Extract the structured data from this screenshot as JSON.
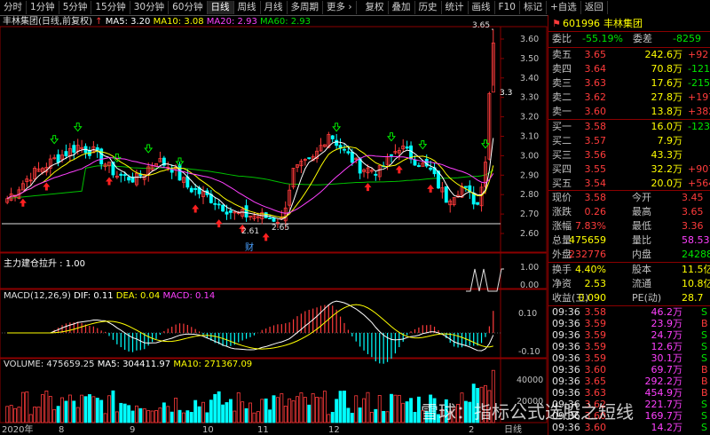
{
  "toolbar": {
    "items": [
      "分时",
      "1分钟",
      "5分钟",
      "15分钟",
      "30分钟",
      "60分钟",
      "日线",
      "周线",
      "月线",
      "多周期",
      "更多 ›"
    ],
    "right_items": [
      "复权",
      "叠加",
      "历史",
      "统计",
      "画线",
      "F10",
      "标记",
      "+自选",
      "返回"
    ]
  },
  "chart_header": {
    "name": "丰林集团(日线,前复权)",
    "ma5": "MA5: 3.20",
    "ma10": "MA10: 3.08",
    "ma20": "MA20: 2.93",
    "ma60": "MA60: 2.93"
  },
  "annotations": {
    "high_label": "3.65",
    "low_label": "2.65",
    "low_label2": "2.61",
    "cai_label": "财",
    "year_label": "2020年",
    "tick_label": "3.3"
  },
  "main_axis": {
    "labels": [
      "3.60",
      "3.50",
      "3.40",
      "3.30",
      "3.20",
      "3.10",
      "3.00",
      "2.90",
      "2.80",
      "2.70",
      "2.60"
    ]
  },
  "indicator1": {
    "label": "主力建仓拉升 : 1.00",
    "axis": [
      "1.00",
      "0.00"
    ]
  },
  "macd": {
    "label": "MACD(12,26,9)",
    "dif": "DIF: 0.11",
    "dea": "DEA: 0.04",
    "macd": "MACD: 0.14",
    "axis": [
      "0.10",
      "-0.10"
    ]
  },
  "volume": {
    "label": "VOLUME: 475659.25",
    "ma5": "MA5: 304411.97",
    "ma10": "MA10: 271367.09",
    "axis": [
      "40000",
      "20000"
    ]
  },
  "x_axis": {
    "labels": [
      "2020年",
      "8",
      "9",
      "10",
      "11",
      "12",
      "2"
    ]
  },
  "period_label": "日线",
  "quote": {
    "code": "601996",
    "name": "丰林集团",
    "weibi_label": "委比",
    "weibi": "-55.19%",
    "weicha_label": "委差",
    "weicha": "-8259",
    "asks": [
      {
        "label": "卖五",
        "price": "3.65",
        "vol": "242.6万",
        "chg": "+92"
      },
      {
        "label": "卖四",
        "price": "3.64",
        "vol": "70.8万",
        "chg": "-1213"
      },
      {
        "label": "卖三",
        "price": "3.63",
        "vol": "17.6万",
        "chg": "-2154"
      },
      {
        "label": "卖二",
        "price": "3.62",
        "vol": "27.8万",
        "chg": "+197"
      },
      {
        "label": "卖一",
        "price": "3.60",
        "vol": "13.8万",
        "chg": "+382"
      }
    ],
    "bids": [
      {
        "label": "买一",
        "price": "3.58",
        "vol": "16.0万",
        "chg": "-123"
      },
      {
        "label": "买二",
        "price": "3.57",
        "vol": "7.9万",
        "chg": ""
      },
      {
        "label": "买三",
        "price": "3.56",
        "vol": "43.3万",
        "chg": ""
      },
      {
        "label": "买四",
        "price": "3.55",
        "vol": "32.2万",
        "chg": "+907"
      },
      {
        "label": "买五",
        "price": "3.54",
        "vol": "20.0万",
        "chg": "+564"
      }
    ],
    "stats": [
      {
        "l1": "现价",
        "v1": "3.58",
        "l2": "今开",
        "v2": "3.45"
      },
      {
        "l1": "涨跌",
        "v1": "0.26",
        "l2": "最高",
        "v2": "3.65"
      },
      {
        "l1": "涨幅",
        "v1": "7.83%",
        "l2": "最低",
        "v2": "3.36"
      },
      {
        "l1": "总量",
        "v1": "475659",
        "l2": "量比",
        "v2": "58.53"
      },
      {
        "l1": "外盘",
        "v1": "232776",
        "l2": "内盘",
        "v2": "242883"
      }
    ],
    "stats2": [
      {
        "l1": "换手",
        "v1": "4.40%",
        "l2": "股本",
        "v2": "11.5亿"
      },
      {
        "l1": "净资",
        "v1": "2.53",
        "l2": "流通",
        "v2": "10.8亿"
      },
      {
        "l1": "收益(三)",
        "v1": "0.090",
        "l2": "PE(动)",
        "v2": "28.7"
      }
    ],
    "ticks": [
      {
        "t": "09:36",
        "p": "3.58",
        "v": "46.2万",
        "s": "S"
      },
      {
        "t": "09:36",
        "p": "3.59",
        "v": "23.9万",
        "s": "B"
      },
      {
        "t": "09:36",
        "p": "3.59",
        "v": "24.7万",
        "s": "S"
      },
      {
        "t": "09:36",
        "p": "3.59",
        "v": "12.6万",
        "s": "S"
      },
      {
        "t": "09:36",
        "p": "3.59",
        "v": "30.1万",
        "s": "S"
      },
      {
        "t": "09:36",
        "p": "3.60",
        "v": "69.7万",
        "s": "B"
      },
      {
        "t": "09:36",
        "p": "3.65",
        "v": "292.2万",
        "s": "B"
      },
      {
        "t": "09:36",
        "p": "3.63",
        "v": "454.9万",
        "s": "B"
      },
      {
        "t": "09:36",
        "p": "3.62",
        "v": "221.7万",
        "s": "S"
      },
      {
        "t": "09:36",
        "p": "3.60",
        "v": "169.7万",
        "s": "S"
      },
      {
        "t": "09:36",
        "p": "3.60",
        "v": "14.2万",
        "s": "S"
      }
    ]
  },
  "watermark": "雪球：指标公式选股之短线",
  "colors": {
    "up": "#ff3b3b",
    "down": "#00ffff",
    "ma5": "#ffffff",
    "ma10": "#ffff00",
    "ma20": "#ff40ff",
    "ma60": "#00c000"
  }
}
